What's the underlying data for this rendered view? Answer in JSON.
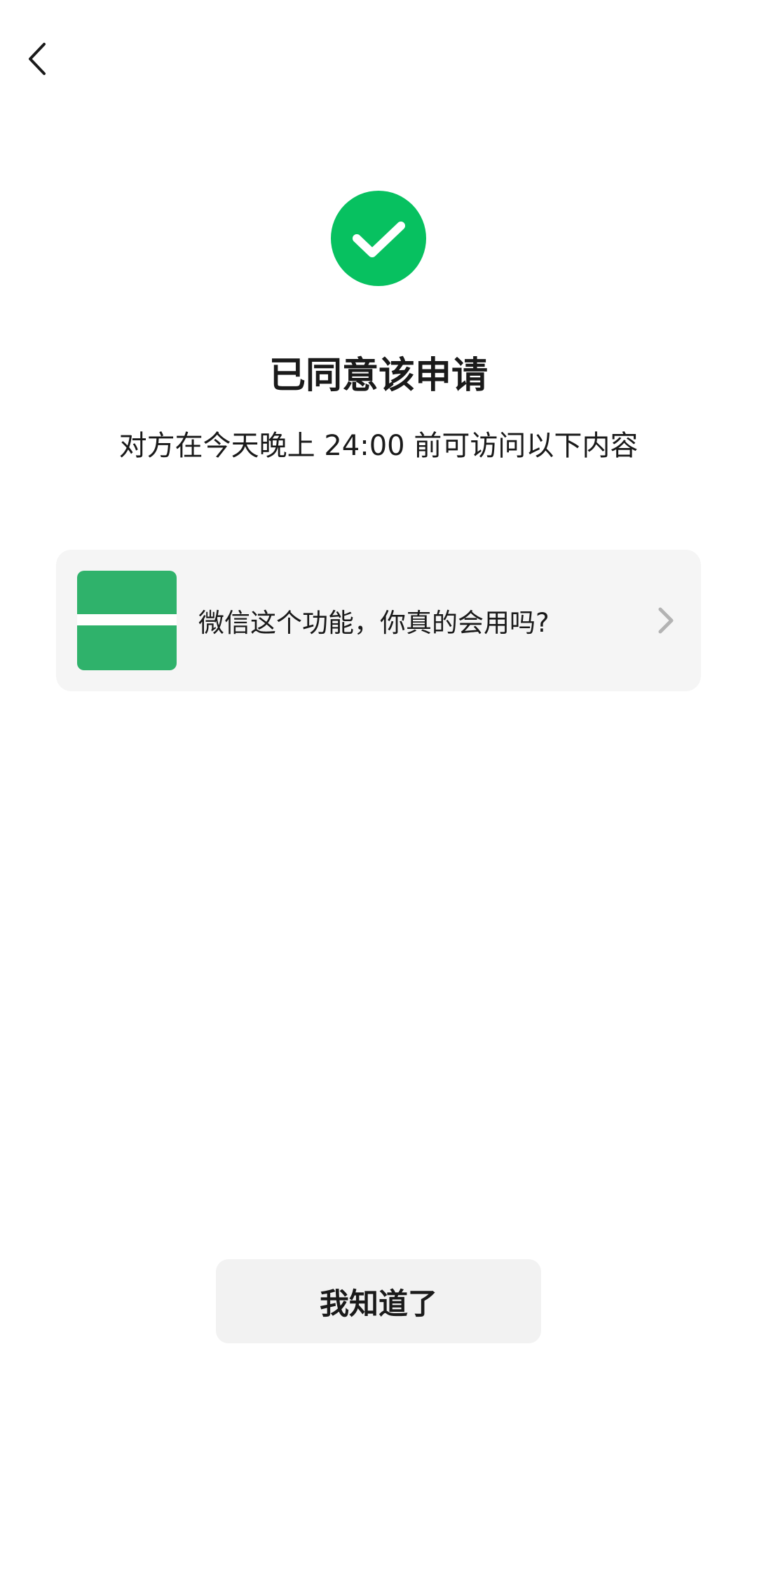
{
  "header": {
    "back_icon": "chevron-left-icon"
  },
  "status": {
    "icon": "check-circle-icon",
    "color": "#07c160",
    "title": "已同意该申请",
    "subtitle": "对方在今天晚上 24:00 前可访问以下内容"
  },
  "article": {
    "thumbnail_icon": "article-thumbnail",
    "thumbnail_color": "#2fb26b",
    "title": "微信这个功能，你真的会用吗?",
    "chevron_icon": "chevron-right-icon"
  },
  "footer": {
    "button_label": "我知道了"
  }
}
